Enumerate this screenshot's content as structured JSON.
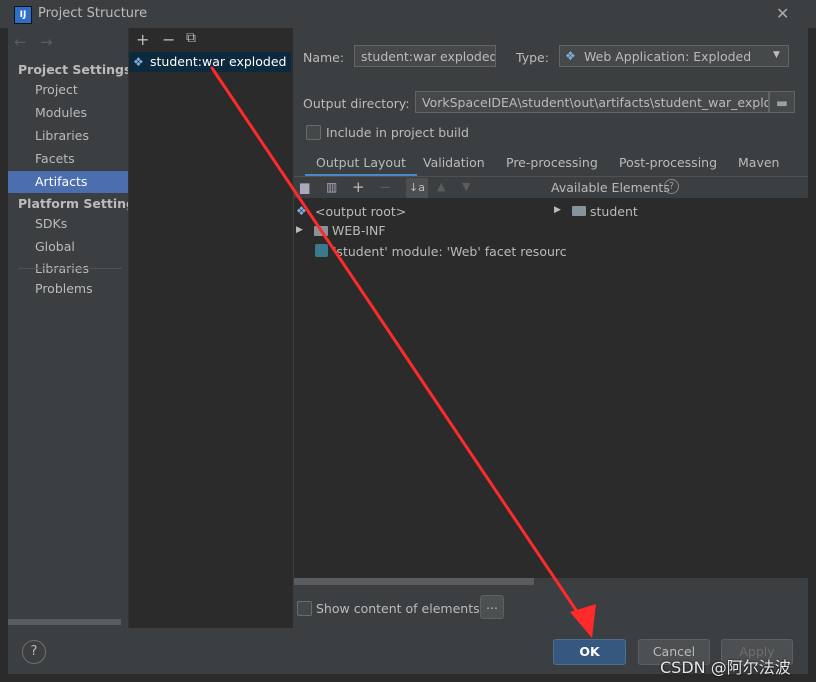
{
  "window": {
    "title": "Project Structure",
    "close_glyph": "✕",
    "app_icon_text": "IJ"
  },
  "left_nav": {
    "project_settings": "Project Settings",
    "platform_settings": "Platform Settings",
    "items": [
      "Project",
      "Modules",
      "Libraries",
      "Facets",
      "Artifacts"
    ],
    "platform_items": [
      "SDKs",
      "Global Libraries"
    ],
    "problems": "Problems",
    "selected": "Artifacts"
  },
  "artifact_toolbar": {
    "add": "+",
    "remove": "−",
    "copy": "⧉"
  },
  "artifacts": [
    {
      "name": "student:war exploded"
    }
  ],
  "main": {
    "name_label": "Name:",
    "name_value": "student:war exploded",
    "type_label": "Type:",
    "type_value": "Web Application: Exploded",
    "output_dir_label": "Output directory:",
    "output_dir_value": "VorkSpaceIDEA\\student\\out\\artifacts\\student_war_exploded",
    "include_label": "Include in project build",
    "tabs": [
      "Output Layout",
      "Validation",
      "Pre-processing",
      "Post-processing",
      "Maven"
    ],
    "selected_tab": "Output Layout",
    "available_elements": "Available Elements",
    "layout_tree": [
      "<output root>",
      "WEB-INF",
      "'student' module: 'Web' facet resourc"
    ],
    "available_tree": [
      "student"
    ],
    "show_content_label": "Show content of elements",
    "more_button": "..."
  },
  "buttons": {
    "help": "?",
    "ok": "OK",
    "cancel": "Cancel",
    "apply": "Apply"
  },
  "watermark": "CSDN @阿尔法波",
  "colors": {
    "accent": "#4b6eaf",
    "annotation_arrow": "#ff2a2a"
  }
}
